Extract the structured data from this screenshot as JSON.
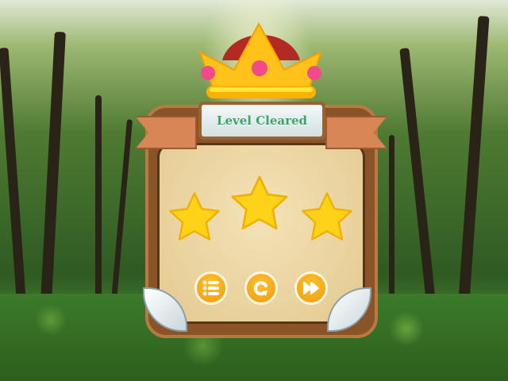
{
  "title": "Level Cleared",
  "stars_earned": 3,
  "stars_total": 3,
  "buttons": [
    {
      "name": "menu-button",
      "icon": "list-icon"
    },
    {
      "name": "replay-button",
      "icon": "restart-icon"
    },
    {
      "name": "next-button",
      "icon": "fast-forward-icon"
    }
  ],
  "colors": {
    "star": "#ffd21a",
    "button": "#f5a515",
    "title": "#3aa56a",
    "wood": "#8a5428"
  }
}
